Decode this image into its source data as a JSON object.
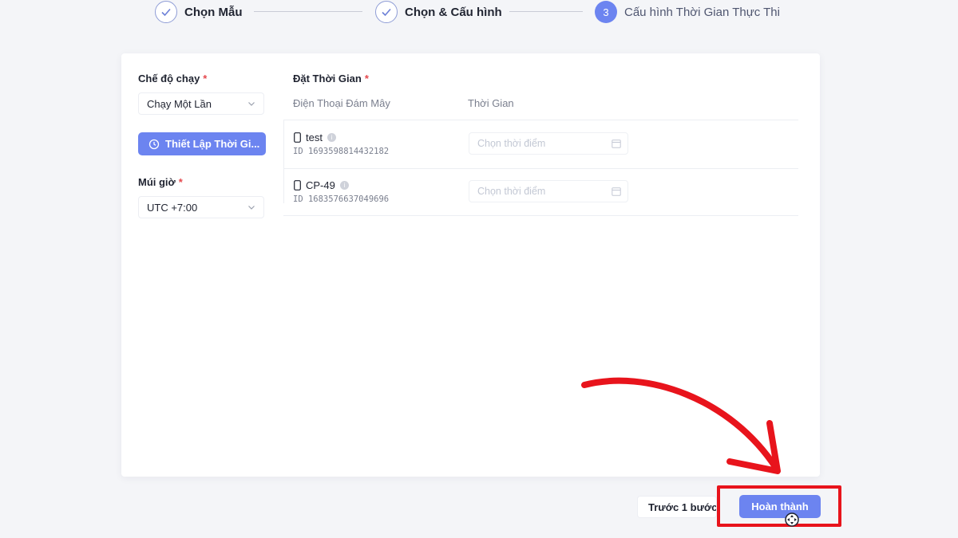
{
  "stepper": {
    "steps": [
      {
        "label": "Chọn Mẫu",
        "state": "done"
      },
      {
        "label": "Chọn & Cấu hình",
        "state": "done"
      },
      {
        "label": "Cấu hình Thời Gian Thực Thi",
        "state": "active",
        "number": "3"
      }
    ]
  },
  "form": {
    "run_mode": {
      "label": "Chế độ chạy",
      "required_mark": "*",
      "value": "Chạy Một Lần"
    },
    "set_time_button": {
      "label": "Thiết Lập Thời Gi...",
      "icon": "clock-icon"
    },
    "timezone": {
      "label": "Múi giờ",
      "required_mark": "*",
      "value": "UTC +7:00"
    }
  },
  "schedule": {
    "title": "Đặt Thời Gian",
    "required_mark": "*",
    "columns": [
      "Điện Thoại Đám Mây",
      "Thời Gian"
    ],
    "rows": [
      {
        "name": "test",
        "id": "ID 1693598814432182",
        "time_placeholder": "Chọn thời điểm"
      },
      {
        "name": "CP-49",
        "id": "ID 1683576637049696",
        "time_placeholder": "Chọn thời điểm"
      }
    ]
  },
  "footer": {
    "back_label": "Trước 1 bước",
    "finish_label": "Hoàn thành"
  },
  "colors": {
    "primary": "#6c84f0",
    "annotation_red": "#e8141c",
    "required": "#e5484d"
  }
}
